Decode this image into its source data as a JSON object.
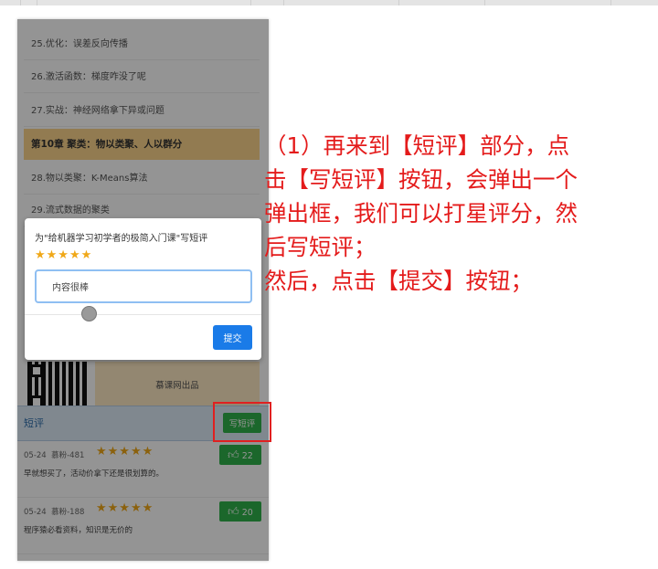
{
  "lessons": [
    {
      "label": "25.优化：误差反向传播"
    },
    {
      "label": "26.激活函数：梯度咋没了呢"
    },
    {
      "label": "27.实战：神经网络拿下异或问题"
    },
    {
      "label": "第10章 聚类：物以类聚、人以群分",
      "chapter": true
    },
    {
      "label": "28.物以类聚：K-Means算法"
    },
    {
      "label": "29.流式数据的聚类"
    }
  ],
  "brand_text": "慕课网出品",
  "review_section": {
    "title": "短评",
    "write_button": "写短评"
  },
  "reviews": [
    {
      "date": "05-24",
      "user": "慕粉-481",
      "rating": 5,
      "stars": "★★★★★",
      "text": "早就想买了，活动价拿下还是很划算的。",
      "likes": "22"
    },
    {
      "date": "05-24",
      "user": "慕粉-188",
      "rating": 5,
      "stars": "★★★★★",
      "text": "程序猿必看资料，知识是无价的",
      "likes": "20"
    }
  ],
  "modal": {
    "title": "为\"给机器学习初学者的极简入门课\"写短评",
    "rating": 5,
    "stars": "★★★★★",
    "input_value": "内容很棒",
    "submit_label": "提交"
  },
  "note_lines": [
    "（1）再来到【短评】部分，点",
    "击【写短评】按钮，会弹出一个",
    "弹出框，我们可以打星评分，然",
    "后写短评；",
    "然后，点击【提交】按钮；"
  ],
  "colors": {
    "annotation_red": "#e41b1b",
    "star": "#f0a818",
    "green_button": "#2fb24a",
    "submit_blue": "#1a7be8"
  },
  "icons": {
    "like": "thumbs-up-icon",
    "qr": "qr-code-icon"
  }
}
